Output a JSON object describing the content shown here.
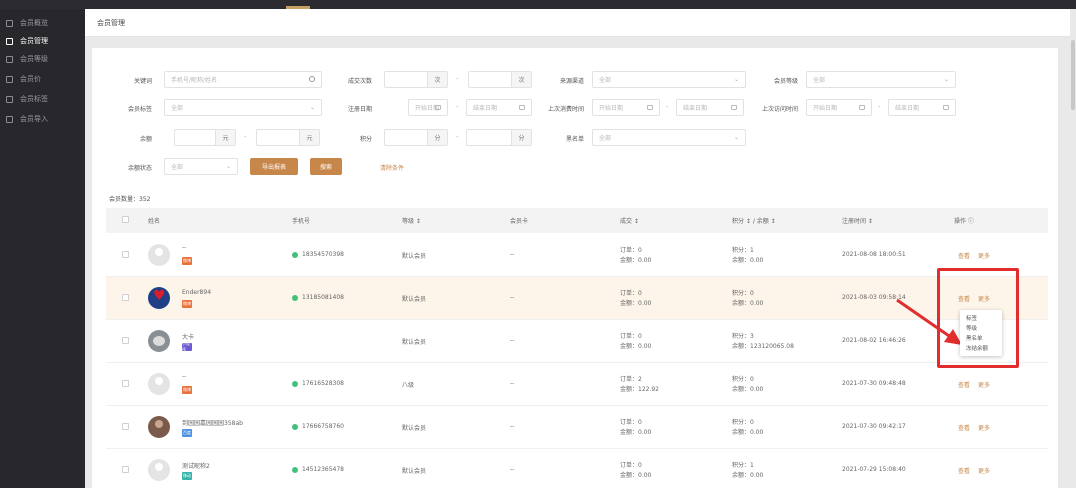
{
  "sidebar": {
    "items": [
      {
        "label": "会员概览",
        "active": false
      },
      {
        "label": "会员管理",
        "active": true
      },
      {
        "label": "会员等级",
        "active": false
      },
      {
        "label": "会员价",
        "active": false
      },
      {
        "label": "会员标签",
        "active": false
      },
      {
        "label": "会员导入",
        "active": false
      }
    ]
  },
  "header": {
    "title": "会员管理"
  },
  "filters": {
    "keyword_label": "关键词",
    "keyword_placeholder": "手机号/昵称/姓名",
    "deal_count_label": "成交次数",
    "deal_unit": "次",
    "source_label": "来源渠道",
    "source_value": "全部",
    "level_label": "会员等级",
    "level_value": "全部",
    "tag_label": "会员标签",
    "tag_value": "全部",
    "register_label": "注册日期",
    "last_consume_label": "上次消费时间",
    "last_visit_label": "上次访问时间",
    "start_placeholder": "开始日期",
    "end_placeholder": "结束日期",
    "balance_label": "余额",
    "balance_unit": "元",
    "points_label": "积分",
    "points_unit": "分",
    "blacklist_label": "黑名单",
    "blacklist_value": "全部",
    "balance_status_label": "余额状态",
    "balance_status_value": "全部",
    "dash": "-",
    "export_btn": "导出报表",
    "search_btn": "搜索",
    "clear_btn": "清除条件"
  },
  "member_count": "会员数量：352",
  "table": {
    "headers": {
      "name": "姓名",
      "phone": "手机号",
      "level": "等级 ↕",
      "card": "会员卡",
      "deal": "成交 ↕",
      "points_balance": "积分 ↕ / 余额 ↕",
      "register_time": "注册时间 ↕",
      "actions": "操作 ⓘ"
    },
    "rows": [
      {
        "name": "--",
        "badge": "wb",
        "badge_text": "微博",
        "phone": "18354570398",
        "level": "默认会员",
        "card": "--",
        "orders": "订单：0",
        "amount": "金额：0.00",
        "points": "积分：1",
        "balance": "余额：0.00",
        "register": "2021-08-08 18:00:51",
        "avatar": "default"
      },
      {
        "name": "Ender894",
        "badge": "wb",
        "badge_text": "微博",
        "phone": "13185081408",
        "level": "默认会员",
        "card": "--",
        "orders": "订单：0",
        "amount": "金额：0.00",
        "points": "积分：0",
        "balance": "余额：0.00",
        "register": "2021-08-03 09:58:14",
        "avatar": "heart"
      },
      {
        "name": "大卡",
        "badge": "mp",
        "badge_text": "小程序",
        "phone": "",
        "level": "默认会员",
        "card": "--",
        "orders": "订单：0",
        "amount": "金额：0.00",
        "points": "积分：3",
        "balance": "余额：123120065.08",
        "register": "2021-08-02 16:46:26",
        "avatar": "cat"
      },
      {
        "name": "--",
        "badge": "wb",
        "badge_text": "微博",
        "phone": "17616528308",
        "level": "八级",
        "card": "--",
        "orders": "订单：2",
        "amount": "金额：122.92",
        "points": "积分：0",
        "balance": "余额：0.00",
        "register": "2021-07-30 09:48:48",
        "avatar": "default"
      },
      {
        "name": "到园园嘉园园园358ab",
        "badge": "bd",
        "badge_text": "百度",
        "phone": "17666758760",
        "level": "默认会员",
        "card": "--",
        "orders": "订单：0",
        "amount": "金额：0.00",
        "points": "积分：0",
        "balance": "余额：0.00",
        "register": "2021-07-30 09:42:17",
        "avatar": "food"
      },
      {
        "name": "测试昵称2",
        "badge": "mo",
        "badge_text": "移动",
        "phone": "14512365478",
        "level": "默认会员",
        "card": "--",
        "orders": "订单：0",
        "amount": "金额：0.00",
        "points": "积分：1",
        "balance": "余额：0.00",
        "register": "2021-07-29 15:08:40",
        "avatar": "default"
      }
    ],
    "view_label": "查看",
    "more_label": "更多"
  },
  "dropdown": {
    "items": [
      "标签",
      "等级",
      "黑名单",
      "冻结余额"
    ]
  },
  "colors": {
    "accent": "#c8874a",
    "sidebar_bg": "#27272c",
    "annotation": "#e12d2d",
    "row_highlight": "#fdf4ea"
  }
}
